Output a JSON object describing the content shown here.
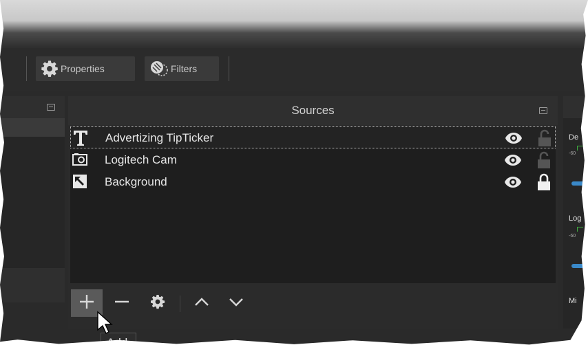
{
  "toolbar": {
    "properties_label": "Properties",
    "filters_label": "Filters"
  },
  "sources": {
    "title": "Sources",
    "items": [
      {
        "name": "Advertizing TipTicker",
        "icon": "text-source-icon",
        "visible": true,
        "locked": false,
        "selected": true
      },
      {
        "name": "Logitech Cam",
        "icon": "camera-source-icon",
        "visible": true,
        "locked": false,
        "selected": false
      },
      {
        "name": "Background",
        "icon": "image-source-icon",
        "visible": true,
        "locked": true,
        "selected": false
      }
    ],
    "footer_buttons": [
      "add-icon",
      "remove-icon",
      "gear-icon",
      "move-up-icon",
      "move-down-icon"
    ]
  },
  "mixer": {
    "channels": [
      "De",
      "Log",
      "Mi"
    ],
    "tick": "-60"
  },
  "tooltip": {
    "text": "Add"
  },
  "colors": {
    "panel_bg": "#2b2b2b",
    "list_bg": "#1e1e1e",
    "text": "#e6e6e6",
    "accent_blue": "#3a89c9",
    "meter_green": "#3fae3f"
  }
}
